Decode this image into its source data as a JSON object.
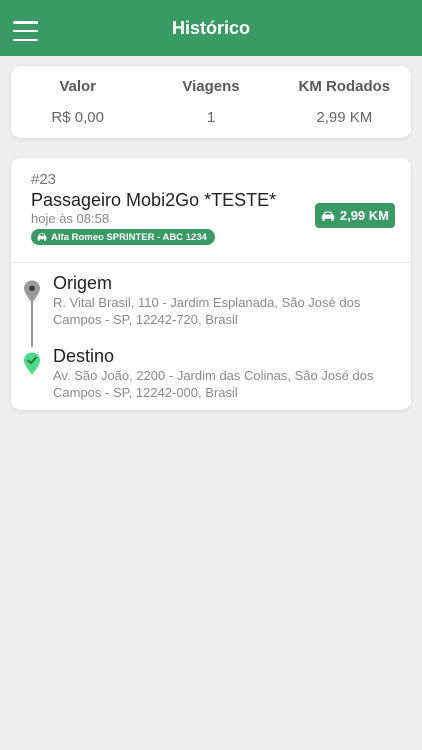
{
  "header": {
    "title": "Histórico",
    "menu_icon": "hamburger-menu-icon"
  },
  "stats": {
    "labels": [
      "Valor",
      "Viagens",
      "KM Rodados"
    ],
    "values": [
      "R$ 0,00",
      "1",
      "2,99 KM"
    ]
  },
  "trip": {
    "id": "#23",
    "passenger": "Passageiro Mobi2Go *TESTE*",
    "time": "hoje às 08:58",
    "vehicle": "Alfa Romeo SPRINTER - ABC 1234",
    "distance": "2,99 KM",
    "origin": {
      "label": "Origem",
      "address": "R. Vital Brasil, 110 - Jardim Esplanada, São José dos Campos - SP, 12242-720, Brasil"
    },
    "destination": {
      "label": "Destino",
      "address": "Av. São João, 2200 - Jardim das Colinas, São José dos Campos - SP, 12242-000, Brasil"
    }
  },
  "colors": {
    "primary": "#3a9a64",
    "background": "#efefef",
    "pin_origin": "#9a9a9a",
    "pin_destination": "#4cd98a"
  }
}
